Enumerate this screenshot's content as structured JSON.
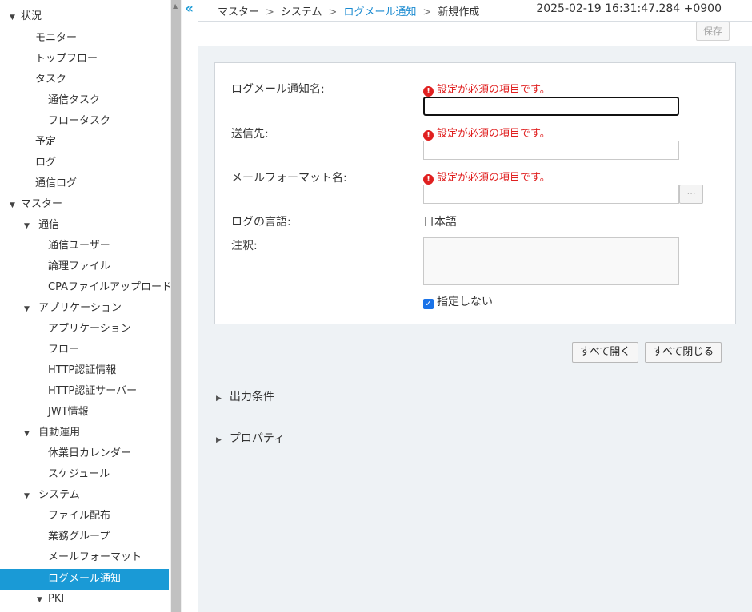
{
  "sidebar": {
    "items": [
      {
        "label": "状況",
        "expanded": true
      },
      {
        "label": "モニター"
      },
      {
        "label": "トップフロー"
      },
      {
        "label": "タスク"
      },
      {
        "label": "通信タスク"
      },
      {
        "label": "フロータスク"
      },
      {
        "label": "予定"
      },
      {
        "label": "ログ"
      },
      {
        "label": "通信ログ"
      },
      {
        "label": "マスター",
        "expanded": true
      },
      {
        "label": "通信",
        "expanded": true
      },
      {
        "label": "通信ユーザー"
      },
      {
        "label": "論理ファイル"
      },
      {
        "label": "CPAファイルアップロード"
      },
      {
        "label": "アプリケーション",
        "expanded": true
      },
      {
        "label": "アプリケーション"
      },
      {
        "label": "フロー"
      },
      {
        "label": "HTTP認証情報"
      },
      {
        "label": "HTTP認証サーバー"
      },
      {
        "label": "JWT情報"
      },
      {
        "label": "自動運用",
        "expanded": true
      },
      {
        "label": "休業日カレンダー"
      },
      {
        "label": "スケジュール"
      },
      {
        "label": "システム",
        "expanded": true
      },
      {
        "label": "ファイル配布"
      },
      {
        "label": "業務グループ"
      },
      {
        "label": "メールフォーマット"
      },
      {
        "label": "ログメール通知",
        "selected": true
      },
      {
        "label": "PKI",
        "expanded": true
      }
    ],
    "collapse_glyph": "«"
  },
  "breadcrumb": {
    "items": [
      "マスター",
      "システム",
      "ログメール通知",
      "新規作成"
    ],
    "separator": ">"
  },
  "clock": "2025-02-19 16:31:47.284 +0900",
  "toolbar": {
    "save_label": "保存"
  },
  "form": {
    "name_label": "ログメール通知名:",
    "recipient_label": "送信先:",
    "mail_format_label": "メールフォーマット名:",
    "language_label": "ログの言語:",
    "language_value": "日本語",
    "note_label": "注釈:",
    "required_error": "設定が必須の項目です。",
    "browse_button": "⋯",
    "unspecified_label": "指定しない",
    "unspecified_checked": true
  },
  "actions": {
    "open_all": "すべて開く",
    "close_all": "すべて閉じる"
  },
  "sections": {
    "output_conditions": "出力条件",
    "properties": "プロパティ"
  },
  "colors": {
    "accent": "#1a9ad6",
    "error": "#e02020",
    "background": "#eef2f5"
  }
}
